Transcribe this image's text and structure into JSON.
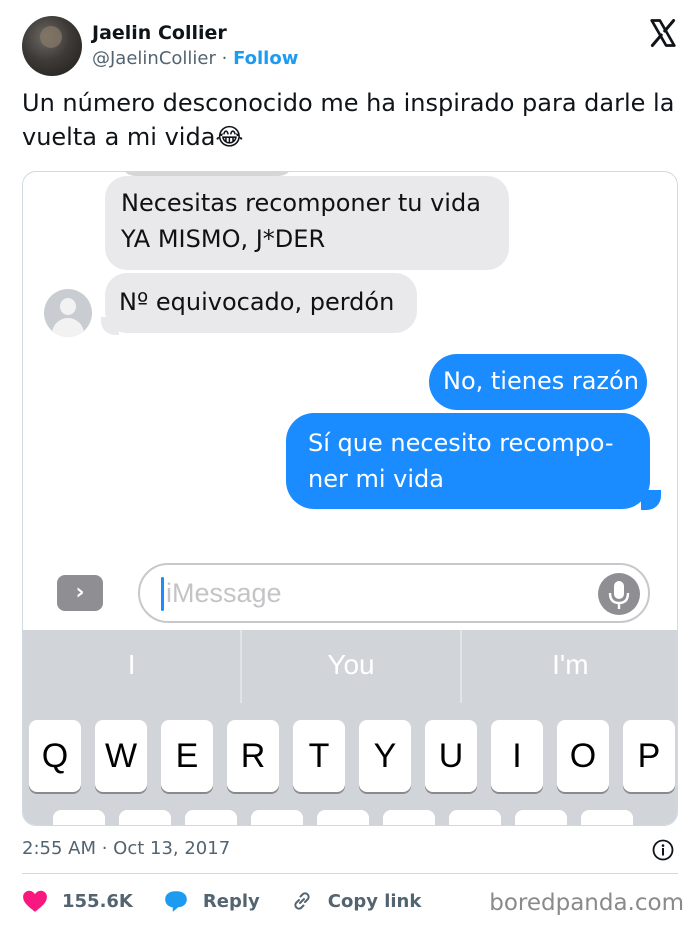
{
  "author": {
    "name": "Jaelin Collier",
    "handle": "@JaelinCollier",
    "separator": " · ",
    "follow_label": "Follow"
  },
  "tweet": {
    "text": "Un número desconocido me ha inspirado para darle la vuelta a mi vida😂"
  },
  "conversation": {
    "messages": [
      {
        "from": "contact",
        "text_line1": "Necesitas recomponer tu vida",
        "text_line2": "YA MISMO, J*DER"
      },
      {
        "from": "contact",
        "text": "Nº equivocado, perdón"
      },
      {
        "from": "me",
        "text": "No, tienes razón"
      },
      {
        "from": "me",
        "text_line1": "Sí que necesito recompo-",
        "text_line2": "ner mi vida"
      }
    ],
    "input_placeholder": "iMessage",
    "expand_glyph": "›"
  },
  "keyboard": {
    "suggestions": [
      "I",
      "You",
      "I'm"
    ],
    "row1": [
      "Q",
      "W",
      "E",
      "R",
      "T",
      "Y",
      "U",
      "I",
      "O",
      "P"
    ]
  },
  "footer": {
    "timestamp": "2:55 AM · Oct 13, 2017",
    "likes": "155.6K",
    "reply_label": "Reply",
    "copy_label": "Copy link",
    "watermark": "boredpanda.com"
  },
  "colors": {
    "accent": "#1d9bf0",
    "like": "#f91880",
    "imessage_blue": "#1a8cff",
    "bubble_gray": "#e9e9eb"
  },
  "icons": [
    "x-logo-icon",
    "info-icon",
    "heart-icon",
    "reply-bubble-icon",
    "link-icon",
    "microphone-icon",
    "chevron-right-icon",
    "contact-avatar-icon"
  ]
}
